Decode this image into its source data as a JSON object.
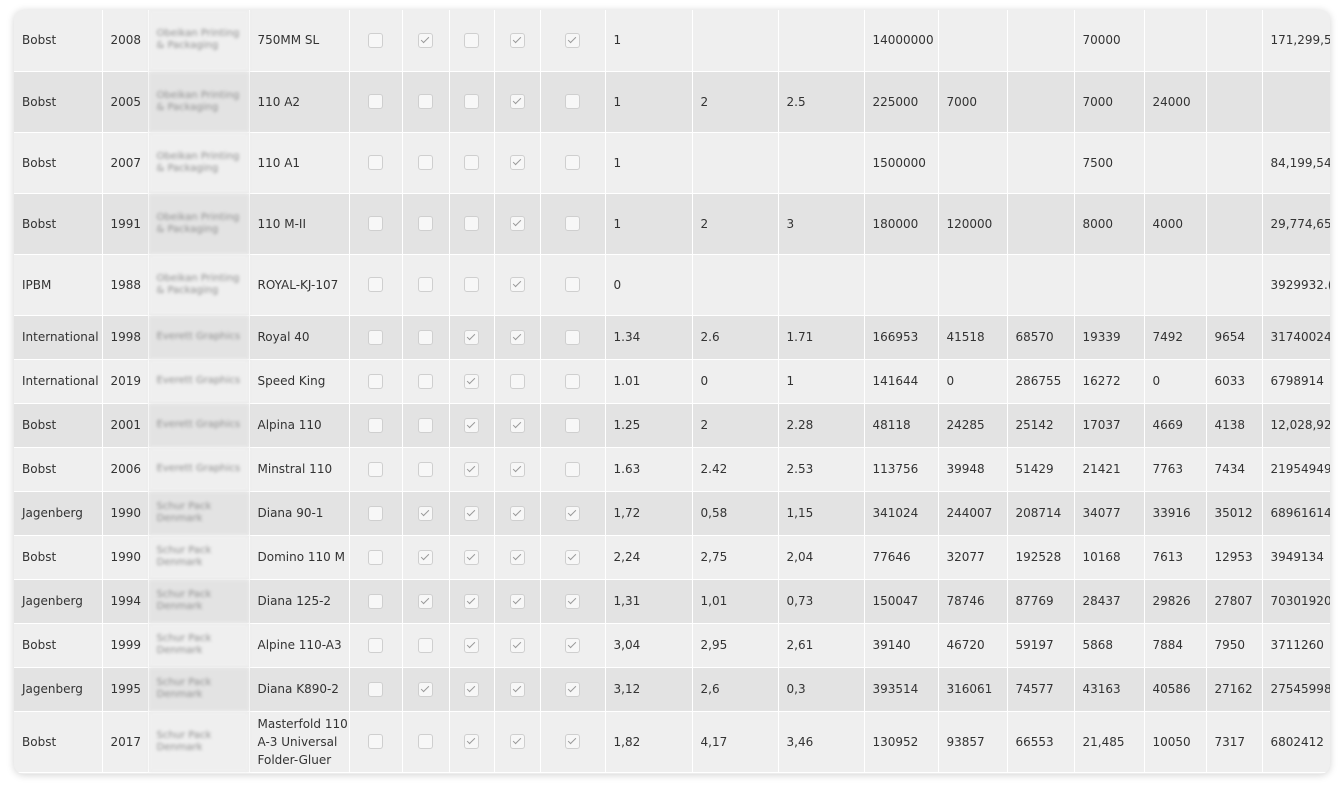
{
  "rows": [
    {
      "make": "Bobst",
      "year": "2008",
      "owner": "Obeikan Printing & Packaging",
      "model": "750MM SL",
      "checks": [
        false,
        true,
        false,
        true,
        true
      ],
      "n1": "1",
      "n2": "",
      "n3": "",
      "v1": "14000000",
      "v2": "",
      "v3": "",
      "v4": "70000",
      "v5": "",
      "v6": "",
      "total": "171,299,5"
    },
    {
      "make": "Bobst",
      "year": "2005",
      "owner": "Obeikan Printing & Packaging",
      "model": "110 A2",
      "checks": [
        false,
        false,
        false,
        true,
        false
      ],
      "n1": "1",
      "n2": "2",
      "n3": "2.5",
      "v1": "225000",
      "v2": "7000",
      "v3": "",
      "v4": "7000",
      "v5": "24000",
      "v6": "",
      "total": ""
    },
    {
      "make": "Bobst",
      "year": "2007",
      "owner": "Obeikan Printing & Packaging",
      "model": "110 A1",
      "checks": [
        false,
        false,
        false,
        true,
        false
      ],
      "n1": "1",
      "n2": "",
      "n3": "",
      "v1": "1500000",
      "v2": "",
      "v3": "",
      "v4": "7500",
      "v5": "",
      "v6": "",
      "total": "84,199,54"
    },
    {
      "make": "Bobst",
      "year": "1991",
      "owner": "Obeikan Printing & Packaging",
      "model": "110 M-II",
      "checks": [
        false,
        false,
        false,
        true,
        false
      ],
      "n1": "1",
      "n2": "2",
      "n3": "3",
      "v1": "180000",
      "v2": "120000",
      "v3": "",
      "v4": "8000",
      "v5": "4000",
      "v6": "",
      "total": "29,774,65"
    },
    {
      "make": "IPBM",
      "year": "1988",
      "owner": "Obeikan Printing & Packaging",
      "model": "ROYAL-KJ-107",
      "checks": [
        false,
        false,
        false,
        true,
        false
      ],
      "n1": "0",
      "n2": "",
      "n3": "",
      "v1": "",
      "v2": "",
      "v3": "",
      "v4": "",
      "v5": "",
      "v6": "",
      "total": "3929932.("
    },
    {
      "make": "International",
      "year": "1998",
      "owner": "Everett Graphics",
      "model": "Royal 40",
      "checks": [
        false,
        false,
        true,
        true,
        false
      ],
      "n1": "1.34",
      "n2": "2.6",
      "n3": "1.71",
      "v1": "166953",
      "v2": "41518",
      "v3": "68570",
      "v4": "19339",
      "v5": "7492",
      "v6": "9654",
      "total": "31740024"
    },
    {
      "make": "International",
      "year": "2019",
      "owner": "Everett Graphics",
      "model": "Speed King",
      "checks": [
        false,
        false,
        true,
        false,
        false
      ],
      "n1": "1.01",
      "n2": "0",
      "n3": "1",
      "v1": "141644",
      "v2": "0",
      "v3": "286755",
      "v4": "16272",
      "v5": "0",
      "v6": "6033",
      "total": "6798914"
    },
    {
      "make": "Bobst",
      "year": "2001",
      "owner": "Everett Graphics",
      "model": "Alpina 110",
      "checks": [
        false,
        false,
        true,
        true,
        false
      ],
      "n1": "1.25",
      "n2": "2",
      "n3": "2.28",
      "v1": "48118",
      "v2": "24285",
      "v3": "25142",
      "v4": "17037",
      "v5": "4669",
      "v6": "4138",
      "total": "12,028,92"
    },
    {
      "make": "Bobst",
      "year": "2006",
      "owner": "Everett Graphics",
      "model": "Minstral 110",
      "checks": [
        false,
        false,
        true,
        true,
        false
      ],
      "n1": "1.63",
      "n2": "2.42",
      "n3": "2.53",
      "v1": "113756",
      "v2": "39948",
      "v3": "51429",
      "v4": "21421",
      "v5": "7763",
      "v6": "7434",
      "total": "21954949"
    },
    {
      "make": "Jagenberg",
      "year": "1990",
      "owner": "Schur Pack Denmark",
      "model": "Diana 90-1",
      "checks": [
        false,
        true,
        true,
        true,
        true
      ],
      "n1": "1,72",
      "n2": "0,58",
      "n3": "1,15",
      "v1": "341024",
      "v2": "244007",
      "v3": "208714",
      "v4": "34077",
      "v5": "33916",
      "v6": "35012",
      "total": "68961614"
    },
    {
      "make": "Bobst",
      "year": "1990",
      "owner": "Schur Pack Denmark",
      "model": "Domino 110 M",
      "checks": [
        false,
        true,
        true,
        true,
        true
      ],
      "n1": "2,24",
      "n2": "2,75",
      "n3": "2,04",
      "v1": "77646",
      "v2": "32077",
      "v3": "192528",
      "v4": "10168",
      "v5": "7613",
      "v6": "12953",
      "total": "3949134"
    },
    {
      "make": "Jagenberg",
      "year": "1994",
      "owner": "Schur Pack Denmark",
      "model": "Diana 125-2",
      "checks": [
        false,
        true,
        true,
        true,
        true
      ],
      "n1": "1,31",
      "n2": "1,01",
      "n3": "0,73",
      "v1": "150047",
      "v2": "78746",
      "v3": "87769",
      "v4": "28437",
      "v5": "29826",
      "v6": "27807",
      "total": "70301920"
    },
    {
      "make": "Bobst",
      "year": "1999",
      "owner": "Schur Pack Denmark",
      "model": "Alpine 110-A3",
      "checks": [
        false,
        false,
        true,
        true,
        true
      ],
      "n1": "3,04",
      "n2": "2,95",
      "n3": "2,61",
      "v1": "39140",
      "v2": "46720",
      "v3": "59197",
      "v4": "5868",
      "v5": "7884",
      "v6": "7950",
      "total": "3711260"
    },
    {
      "make": "Jagenberg",
      "year": "1995",
      "owner": "Schur Pack Denmark",
      "model": "Diana K890-2",
      "checks": [
        false,
        true,
        true,
        true,
        true
      ],
      "n1": "3,12",
      "n2": "2,6",
      "n3": "0,3",
      "v1": "393514",
      "v2": "316061",
      "v3": "74577",
      "v4": "43163",
      "v5": "40586",
      "v6": "27162",
      "total": "27545998"
    },
    {
      "make": "Bobst",
      "year": "2017",
      "owner": "Schur Pack Denmark",
      "model": "Masterfold 110 A-3 Universal Folder-Gluer",
      "checks": [
        false,
        false,
        true,
        true,
        true
      ],
      "n1": "1,82",
      "n2": "4,17",
      "n3": "3,46",
      "v1": "130952",
      "v2": "93857",
      "v3": "66553",
      "v4": "21,485",
      "v5": "10050",
      "v6": "7317",
      "total": "6802412"
    }
  ]
}
